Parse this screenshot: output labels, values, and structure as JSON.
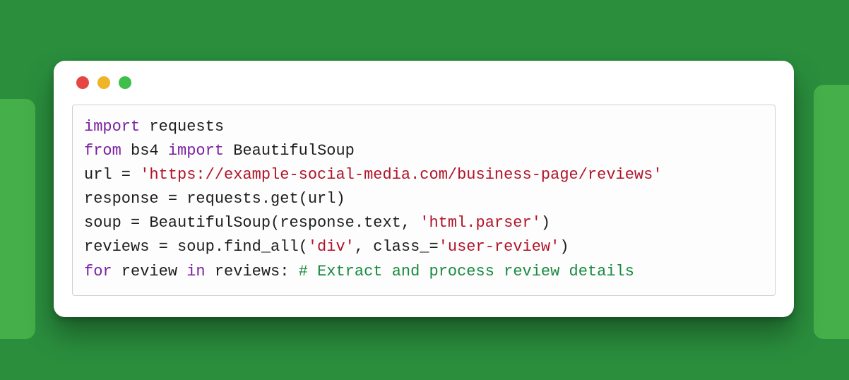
{
  "colors": {
    "bg": "#2a8e3d",
    "bg_shape": "#45b04a",
    "traffic_red": "#e64545",
    "traffic_yellow": "#f0b429",
    "traffic_green": "#3fbf4a",
    "kw": "#7a1fa2",
    "str": "#b01327",
    "cmt": "#188a3f",
    "def": "#1c1c1c"
  },
  "code_lines": [
    [
      {
        "t": "import",
        "c": "kw"
      },
      {
        "t": " requests",
        "c": "def"
      }
    ],
    [
      {
        "t": "from",
        "c": "kw"
      },
      {
        "t": " bs4 ",
        "c": "def"
      },
      {
        "t": "import",
        "c": "kw"
      },
      {
        "t": " BeautifulSoup",
        "c": "def"
      }
    ],
    [
      {
        "t": "url = ",
        "c": "def"
      },
      {
        "t": "'https://example-social-media.com/business-page/reviews'",
        "c": "str"
      }
    ],
    [
      {
        "t": "response = requests.get(url)",
        "c": "def"
      }
    ],
    [
      {
        "t": "soup = BeautifulSoup(response.text, ",
        "c": "def"
      },
      {
        "t": "'html.parser'",
        "c": "str"
      },
      {
        "t": ")",
        "c": "def"
      }
    ],
    [
      {
        "t": "reviews = soup.find_all(",
        "c": "def"
      },
      {
        "t": "'div'",
        "c": "str"
      },
      {
        "t": ", class_=",
        "c": "def"
      },
      {
        "t": "'user-review'",
        "c": "str"
      },
      {
        "t": ")",
        "c": "def"
      }
    ],
    [
      {
        "t": "for",
        "c": "kw"
      },
      {
        "t": " review ",
        "c": "def"
      },
      {
        "t": "in",
        "c": "kw"
      },
      {
        "t": " reviews: ",
        "c": "def"
      },
      {
        "t": "# Extract and process review details",
        "c": "cmt"
      }
    ]
  ]
}
